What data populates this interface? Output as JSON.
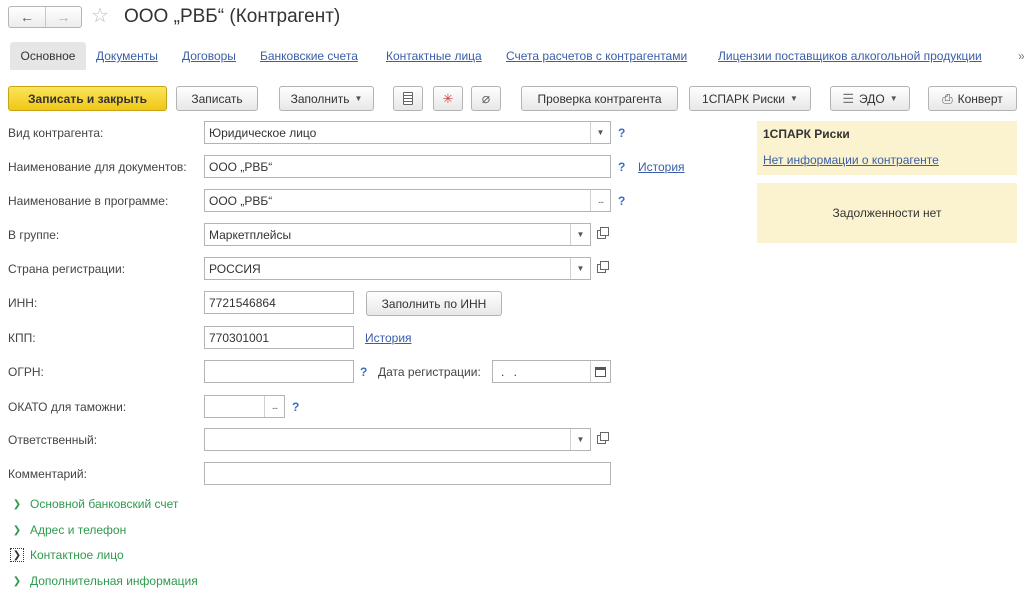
{
  "window": {
    "title": "ООО „РВБ“ (Контрагент)",
    "back_glyph": "←",
    "forward_glyph": "→",
    "favorite_glyph": "☆"
  },
  "tabs": {
    "active": "Основное",
    "links": [
      "Документы",
      "Договоры",
      "Банковские счета",
      "Контактные лица",
      "Счета расчетов с контрагентами",
      "Лицензии поставщиков алкогольной продукции"
    ],
    "more_glyph": "»"
  },
  "toolbar": {
    "save_close": "Записать и закрыть",
    "save": "Записать",
    "fill": "Заполнить",
    "check": "Проверка контрагента",
    "spark": "1СПАРК Риски",
    "edo": "ЭДО",
    "envelope": "Конверт",
    "caret": "▼"
  },
  "icons": {
    "report": "report-icon",
    "structure": "structure-icon",
    "attach": "paperclip-icon",
    "edo": "edo-icon",
    "print": "printer-icon"
  },
  "form": {
    "kind_label": "Вид контрагента:",
    "kind_value": "Юридическое лицо",
    "docname_label": "Наименование для документов:",
    "docname_value": "ООО „РВБ“",
    "progname_label": "Наименование в программе:",
    "progname_value": "ООО „РВБ“",
    "group_label": "В группе:",
    "group_value": "Маркетплейсы",
    "country_label": "Страна регистрации:",
    "country_value": "РОССИЯ",
    "inn_label": "ИНН:",
    "inn_value": "7721546864",
    "inn_fill_button": "Заполнить по ИНН",
    "kpp_label": "КПП:",
    "kpp_value": "770301001",
    "ogrn_label": "ОГРН:",
    "ogrn_value": "",
    "regdate_label": "Дата регистрации:",
    "regdate_value": " .  .",
    "okato_label": "ОКАТО для таможни:",
    "okato_value": "",
    "responsible_label": "Ответственный:",
    "responsible_value": "",
    "comment_label": "Комментарий:",
    "comment_value": "",
    "history_link": "История",
    "help_mark": "?",
    "dots_glyph": "...",
    "dropdown_glyph": "▼"
  },
  "spark_panel": {
    "title": "1СПАРК Риски",
    "link": "Нет информации о контрагенте",
    "debt": "Задолженности нет"
  },
  "groups": [
    "Основной банковский счет",
    "Адрес и телефон",
    "Контактное лицо",
    "Дополнительная информация"
  ],
  "group_chevron": "❯",
  "colors": {
    "primary_button": "#f5d62a",
    "link": "#3a5ea8",
    "group_title": "#2f9a4e",
    "info_panel": "#fbf3cf"
  }
}
